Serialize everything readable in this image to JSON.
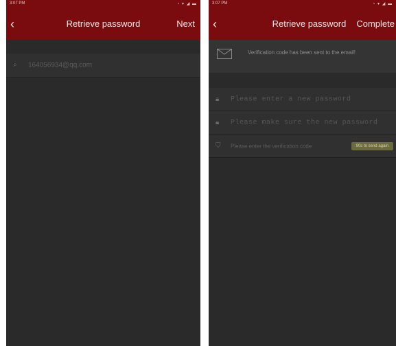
{
  "left": {
    "status_time": "3:07 PM",
    "title": "Retrieve password",
    "action": "Next",
    "email_value": "164056934@qq.com"
  },
  "right": {
    "status_time": "3:07 PM",
    "title": "Retrieve password",
    "action": "Complete",
    "notice": "Verification code has been sent to the email!",
    "new_password_placeholder": "Please enter a new password",
    "confirm_password_placeholder": "Please make sure the new password",
    "code_placeholder": "Please enter the verification code",
    "resend_label": "90s to send again"
  },
  "colors": {
    "appbar": "#7a0b0e",
    "background": "#2a2a2a",
    "resend": "#6b6b3f"
  }
}
